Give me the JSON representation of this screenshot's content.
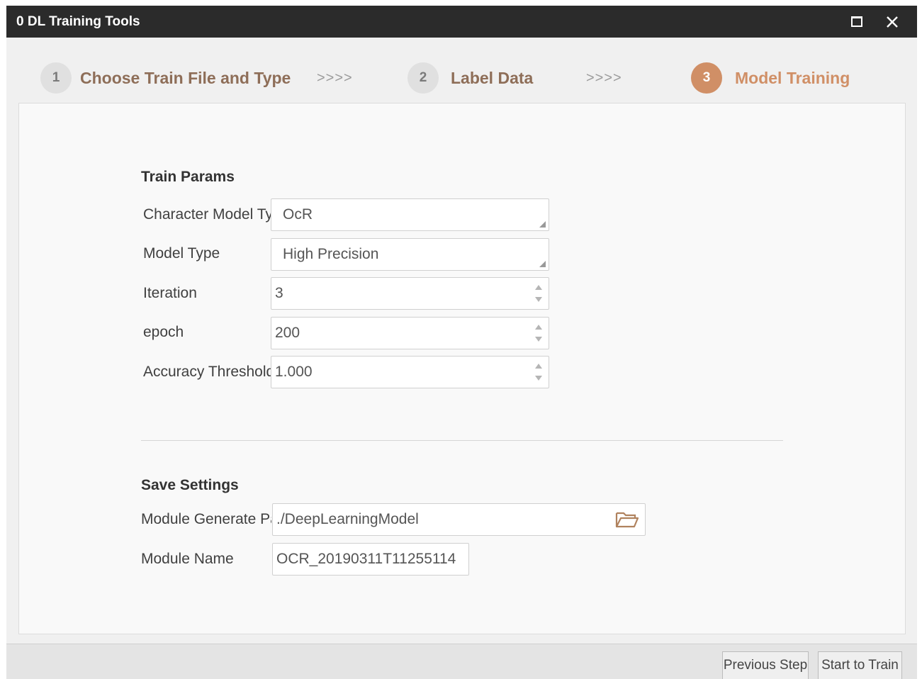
{
  "window": {
    "title": "0 DL Training Tools",
    "maximize_icon": "maximize-icon",
    "close_icon": "close-icon"
  },
  "steps": [
    {
      "number": "1",
      "label": "Choose Train File and Type",
      "active": false
    },
    {
      "number": "2",
      "label": "Label Data",
      "active": false
    },
    {
      "number": "3",
      "label": "Model Training",
      "active": true
    }
  ],
  "step_separator": ">>>>",
  "train_params": {
    "title": "Train Params",
    "character_model_label": "Character Model Type",
    "character_model_value": "OcR",
    "model_type_label": "Model Type",
    "model_type_value": "High Precision",
    "iteration_label": "Iteration",
    "iteration_value": "3",
    "epoch_label": "epoch",
    "epoch_value": "200",
    "accuracy_label": "Accuracy Threshold",
    "accuracy_value": "1.000"
  },
  "save_settings": {
    "title": "Save Settings",
    "generate_path_label": "Module Generate Path",
    "generate_path_value": "./DeepLearningModel",
    "module_name_label": "Module Name",
    "module_name_value": "OCR_20190311T11255114"
  },
  "footer": {
    "previous_label": "Previous Step",
    "start_label": "Start to Train"
  },
  "colors": {
    "active_step": "#d08f66",
    "inactive_step_text": "#8e6e58",
    "titlebar": "#2b2b2b"
  }
}
